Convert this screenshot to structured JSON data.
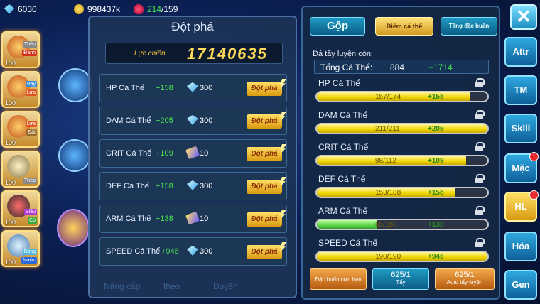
{
  "resources": {
    "diamonds": "6030",
    "gold": "998437k",
    "potion_current": "214",
    "potion_sep": "/",
    "potion_max": "159"
  },
  "heroes": [
    {
      "level": "100",
      "element": "Thép",
      "element2": "Đánh"
    },
    {
      "level": "100",
      "element": "Bay",
      "element2": "Lửa"
    },
    {
      "level": "100",
      "element": "Lửa",
      "element2": "Đất"
    },
    {
      "level": "100",
      "element": "Thép",
      "element2": ""
    },
    {
      "level": "100",
      "element": "Siêu",
      "element2": "Cỏ"
    },
    {
      "level": "100",
      "element": "Băng",
      "element2": "Nước"
    }
  ],
  "breakthrough": {
    "title": "Đột phá",
    "power_label": "Lực chiến",
    "power_value": "17140635",
    "rows": [
      {
        "name": "HP Cá Thể",
        "plus": "+158",
        "cost": "300",
        "cost_icon": "diamond-icon",
        "button": "Đột phá"
      },
      {
        "name": "DAM Cá Thể",
        "plus": "+205",
        "cost": "300",
        "cost_icon": "diamond-icon",
        "button": "Đột phá"
      },
      {
        "name": "CRIT Cá Thể",
        "plus": "+109",
        "cost": "10",
        "cost_icon": "scroll-icon",
        "button": "Đột phá"
      },
      {
        "name": "DEF Cá Thể",
        "plus": "+158",
        "cost": "300",
        "cost_icon": "diamond-icon",
        "button": "Đột phá"
      },
      {
        "name": "ARM Cá Thể",
        "plus": "+138",
        "cost": "10",
        "cost_icon": "scroll-icon",
        "button": "Đột phá"
      },
      {
        "name": "SPEED Cá Thể",
        "plus": "+946",
        "cost": "300",
        "cost_icon": "diamond-icon",
        "button": "Đột phá"
      }
    ],
    "bottom_tabs": [
      "Nâng cấp",
      "theo",
      "Duyên"
    ]
  },
  "panel": {
    "tabs": {
      "gop": "Gộp",
      "diem": "Điểm cá thể",
      "tang": "Tăng đặc huấn"
    },
    "title": "Đá tẩy luyện còn:",
    "total_label": "Tổng Cá Thể:",
    "total_value": "884",
    "total_plus": "+1714",
    "stats": [
      {
        "name": "HP Cá Thể",
        "value": "157/174",
        "plus": "+158",
        "fill": 0.9
      },
      {
        "name": "DAM Cá Thể",
        "value": "211/211",
        "plus": "+205",
        "fill": 1.0
      },
      {
        "name": "CRIT Cá Thể",
        "value": "98/112",
        "plus": "+109",
        "fill": 0.875
      },
      {
        "name": "DEF Cá Thể",
        "value": "153/188",
        "plus": "+158",
        "fill": 0.81
      },
      {
        "name": "ARM Cá Thể",
        "value": "65/188",
        "plus": "+138",
        "fill": 0.35
      },
      {
        "name": "SPEED Cá Thể",
        "value": "190/190",
        "plus": "+946",
        "fill": 1.0
      }
    ],
    "buttons": {
      "dac_huan": "Đặc huấn cực hạn",
      "tay_count": "625/1",
      "tay_label": "Tẩy",
      "auto_count": "625/1",
      "auto_label": "Auto tẩy luyện"
    }
  },
  "side": {
    "close": "✕",
    "buttons": [
      "Attr",
      "TM",
      "Skill",
      "Mặc",
      "HL",
      "Hóa",
      "Gen"
    ],
    "badge": "!"
  },
  "colors": {
    "accent": "#ffd95a",
    "plus": "#47e34d",
    "panel": "#1c3656"
  }
}
